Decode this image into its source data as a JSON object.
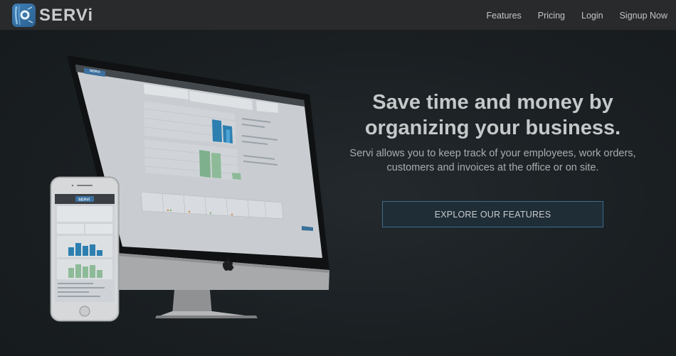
{
  "brand": {
    "name": "SERVi",
    "logo_icon": "servi-logo-icon"
  },
  "nav": {
    "links": [
      {
        "label": "Features"
      },
      {
        "label": "Pricing"
      },
      {
        "label": "Login"
      },
      {
        "label": "Signup Now"
      }
    ]
  },
  "hero": {
    "title_line1": "Save time and money by",
    "title_line2": "organizing your business.",
    "subtitle_line1": "Servi allows you to keep track of your employees, work orders,",
    "subtitle_line2": "customers and invoices at the office or on site.",
    "cta_label": "EXPLORE OUR FEATURES"
  },
  "mockups": {
    "desktop_brand": "SERVi",
    "phone_brand": "SERVi",
    "apple_logo_icon": "apple-icon"
  },
  "colors": {
    "background": "#1a1f22",
    "navbar": "#282a2c",
    "cta_border": "#3d6d8f",
    "chart_blue": "#2d7fb0",
    "chart_green": "#6fa07c"
  }
}
